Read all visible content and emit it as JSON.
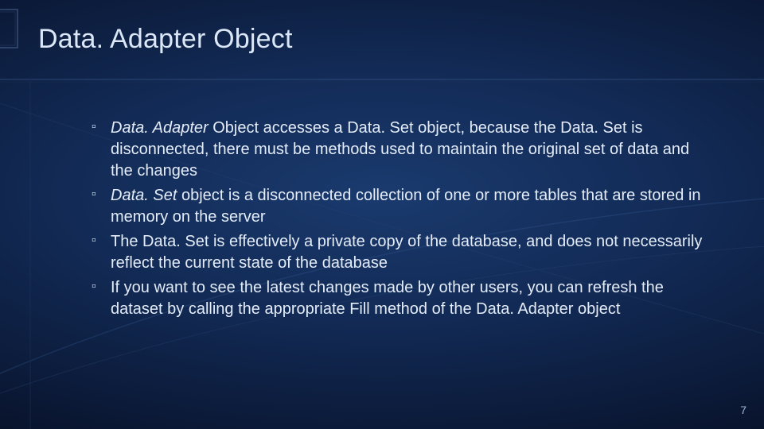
{
  "title": "Data. Adapter Object",
  "bullets": [
    {
      "italic_lead": "Data. Adapter",
      "rest": " Object accesses a Data. Set object, because the Data. Set is disconnected, there must be methods used to maintain the original set of data and the changes"
    },
    {
      "italic_lead": "Data. Set",
      "rest": " object is a disconnected collection of one or more tables that are stored in memory on the server"
    },
    {
      "italic_lead": "",
      "rest": "The Data. Set is effectively a private copy of the database, and does not necessarily reflect the current state of the database"
    },
    {
      "italic_lead": "",
      "rest": "If you want to see the latest changes made by other users, you can refresh the dataset by calling the appropriate Fill method of the Data. Adapter object"
    }
  ],
  "page_number": "7"
}
